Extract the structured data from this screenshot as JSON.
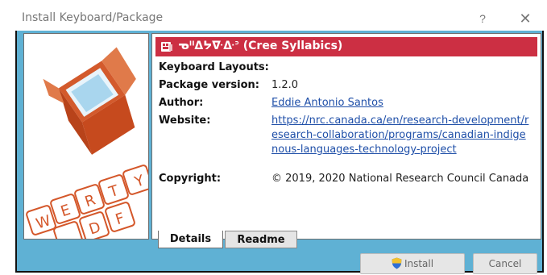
{
  "window": {
    "title": "Install Keyboard/Package",
    "help_glyph": "?",
    "close_glyph": "✕"
  },
  "keyboard": {
    "name": "ᓀᐦᐃᔭᐍᐏᐣ (Cree Syllabics)",
    "name_bar_color": "#cc2f43"
  },
  "details": {
    "layouts_label": "Keyboard Layouts:",
    "version_label": "Package version:",
    "version_value": "1.2.0",
    "author_label": "Author:",
    "author_value": "Eddie Antonio Santos",
    "website_label": "Website:",
    "website_value": "https://nrc.canada.ca/en/research-development/research-collaboration/programs/canadian-indigenous-languages-technology-project",
    "copyright_label": "Copyright:",
    "copyright_value": "© 2019, 2020 National Research Council Canada"
  },
  "tabs": [
    {
      "label": "Details",
      "active": true
    },
    {
      "label": "Readme",
      "active": false
    }
  ],
  "buttons": {
    "install_label": "Install",
    "install_icon": "shield-icon",
    "cancel_label": "Cancel"
  },
  "illustration": {
    "keys": [
      "W",
      "E",
      "R",
      "T",
      "S",
      "D",
      "F"
    ],
    "accent_color": "#d4572a",
    "box_color": "#d35a2c"
  },
  "colors": {
    "client_background": "#5fb1d4",
    "link": "#1f4fa8"
  }
}
